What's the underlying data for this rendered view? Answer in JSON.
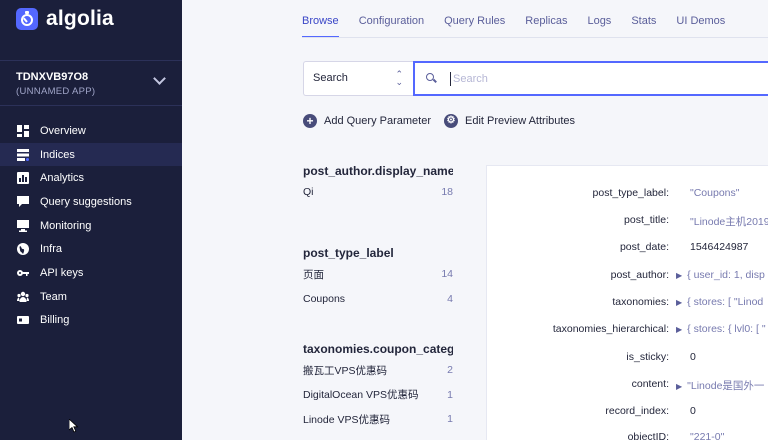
{
  "brand": {
    "name": "algolia",
    "accent": "#5468ff",
    "sidebar_bg": "#1b1f3b"
  },
  "app": {
    "id": "TDNXVB97O8",
    "name": "(UNNAMED APP)"
  },
  "nav": [
    {
      "label": "Overview",
      "icon": "overview-icon"
    },
    {
      "label": "Indices",
      "icon": "indices-icon",
      "active": true
    },
    {
      "label": "Analytics",
      "icon": "analytics-icon"
    },
    {
      "label": "Query suggestions",
      "icon": "query-suggestions-icon"
    },
    {
      "label": "Monitoring",
      "icon": "monitoring-icon"
    },
    {
      "label": "Infra",
      "icon": "globe-icon"
    },
    {
      "label": "API keys",
      "icon": "key-icon"
    },
    {
      "label": "Team",
      "icon": "team-icon"
    },
    {
      "label": "Billing",
      "icon": "billing-icon"
    }
  ],
  "tabs": [
    "Browse",
    "Configuration",
    "Query Rules",
    "Replicas",
    "Logs",
    "Stats",
    "UI Demos"
  ],
  "search": {
    "type_label": "Search",
    "placeholder": "Search"
  },
  "actions": {
    "add_param": "Add Query Parameter",
    "edit_preview": "Edit Preview Attributes"
  },
  "facets": [
    {
      "title": "post_author.display_name",
      "items": [
        {
          "label": "Qi",
          "count": "18"
        }
      ]
    },
    {
      "title": "post_type_label",
      "items": [
        {
          "label": "页面",
          "count": "14"
        },
        {
          "label": "Coupons",
          "count": "4"
        }
      ]
    },
    {
      "title": "taxonomies.coupon_categ",
      "items": [
        {
          "label": "搬瓦工VPS优惠码",
          "count": "2"
        },
        {
          "label": "DigitalOcean VPS优惠码",
          "count": "1"
        },
        {
          "label": "Linode VPS优惠码",
          "count": "1"
        }
      ]
    }
  ],
  "record": [
    {
      "key": "post_type_label:",
      "val": "\"Coupons\"",
      "kind": "str"
    },
    {
      "key": "post_title:",
      "val": "\"Linode主机2019",
      "kind": "str"
    },
    {
      "key": "post_date:",
      "val": "1546424987",
      "kind": "num"
    },
    {
      "key": "post_author:",
      "val": "{ user_id: 1, disp",
      "kind": "obj"
    },
    {
      "key": "taxonomies:",
      "val": "{ stores: [ \"Linod",
      "kind": "obj"
    },
    {
      "key": "taxonomies_hierarchical:",
      "val": "{ stores: { lvl0: [ \"",
      "kind": "obj"
    },
    {
      "key": "is_sticky:",
      "val": "0",
      "kind": "num"
    },
    {
      "key": "content:",
      "val": "\"Linode是国外一",
      "kind": "obj"
    },
    {
      "key": "record_index:",
      "val": "0",
      "kind": "num"
    },
    {
      "key": "objectID:",
      "val": "\"221-0\"",
      "kind": "str"
    }
  ]
}
